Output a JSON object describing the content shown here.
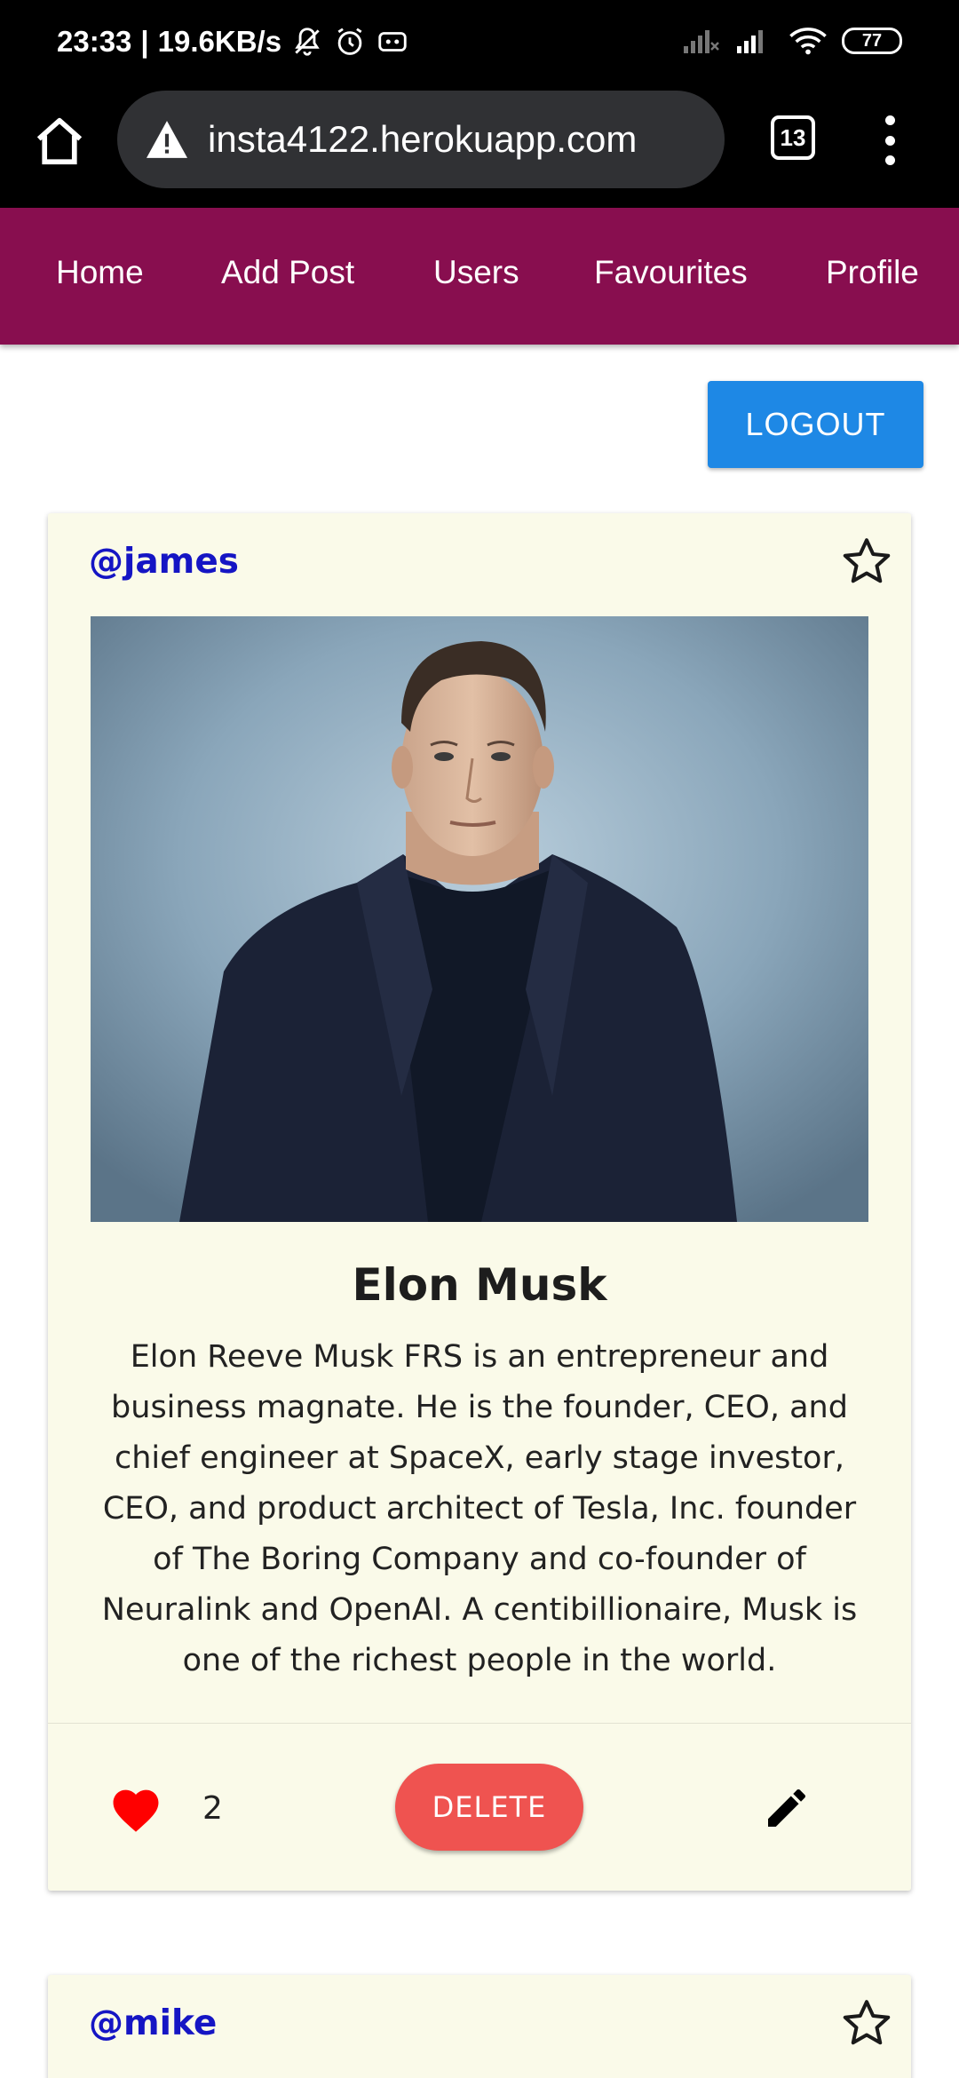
{
  "status_bar": {
    "time": "23:33",
    "speed": "19.6KB/s",
    "battery": "77",
    "icons": [
      "mute-bell-icon",
      "alarm-icon",
      "voicemail-icon",
      "signal-icon",
      "signal-icon",
      "wifi-icon",
      "battery-icon"
    ]
  },
  "browser": {
    "url": "insta4122.herokuapp.com",
    "tab_count": "13",
    "icons": [
      "home-icon",
      "warning-icon",
      "tabs-icon",
      "more-vert-icon"
    ]
  },
  "nav": {
    "background": "#880e4f",
    "items": [
      {
        "label": "Home"
      },
      {
        "label": "Add Post"
      },
      {
        "label": "Users"
      },
      {
        "label": "Favourites"
      },
      {
        "label": "Profile"
      }
    ]
  },
  "logout": {
    "label": "LOGOUT",
    "color": "#1e88e5"
  },
  "posts": [
    {
      "username": "@james",
      "title": "Elon Musk",
      "description": "Elon Reeve Musk FRS is an entrepreneur and business magnate. He is the founder, CEO, and chief engineer at SpaceX, early stage investor, CEO, and product architect of Tesla, Inc. founder of The Boring Company and co-founder of Neuralink and OpenAI. A centibillionaire, Musk is one of the richest people in the world.",
      "likes": "2",
      "delete_label": "DELETE",
      "icons": [
        "star-outline-icon",
        "heart-icon",
        "pencil-icon"
      ]
    },
    {
      "username": "@mike",
      "icons": [
        "star-outline-icon"
      ]
    }
  ],
  "colors": {
    "card_bg": "#fafae9",
    "username": "#1515c4",
    "heart": "#ff0000",
    "delete": "#ef5350"
  }
}
